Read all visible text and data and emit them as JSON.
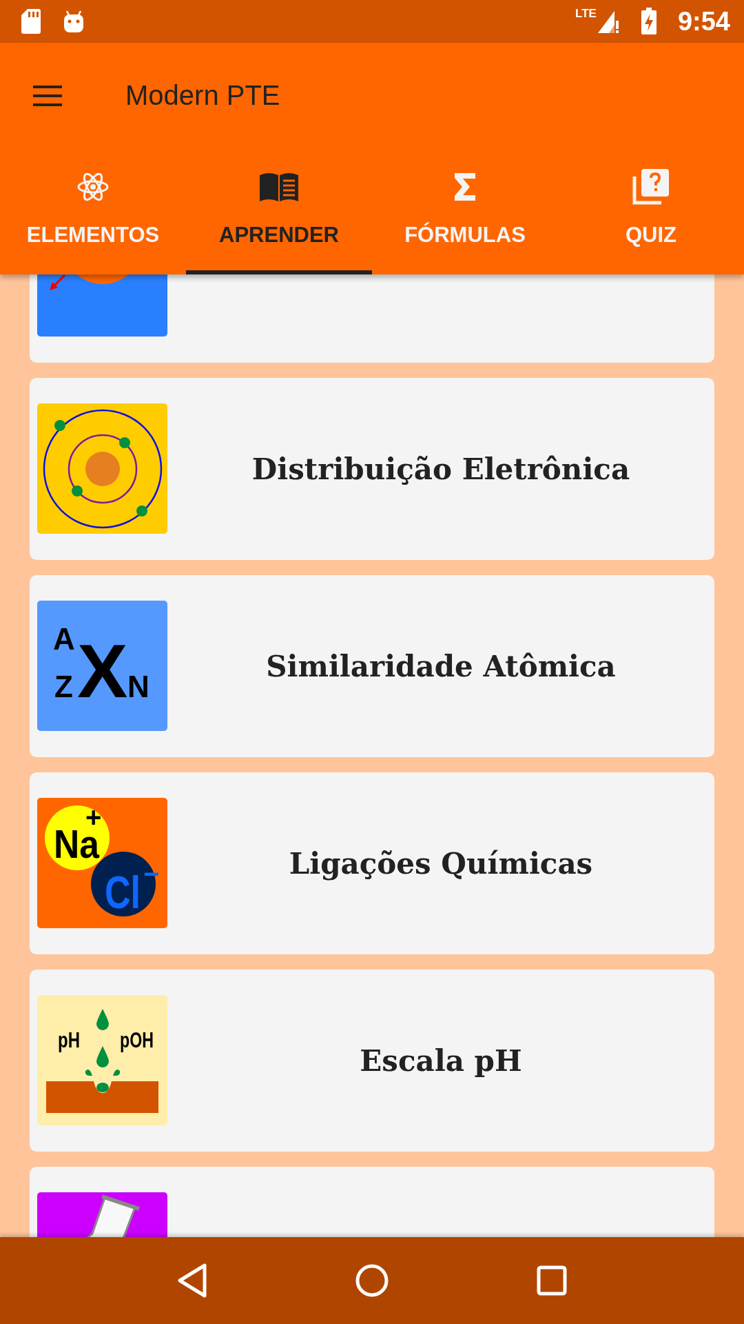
{
  "status_bar": {
    "network": "LTE",
    "time": "9:54"
  },
  "app_bar": {
    "title": "Modern PTE"
  },
  "tabs": [
    {
      "label": "ELEMENTOS",
      "selected": false
    },
    {
      "label": "APRENDER",
      "selected": true
    },
    {
      "label": "FÓRMULAS",
      "selected": false
    },
    {
      "label": "QUIZ",
      "selected": false
    }
  ],
  "topics": [
    {
      "icon": {
        "kind": "pauling"
      }
    },
    {
      "title": "Distribuição Eletrônica",
      "icon": {
        "kind": "orbits"
      }
    },
    {
      "title": "Similaridade Atômica",
      "icon": {
        "kind": "notation",
        "labels": [
          "A",
          "Z",
          "X",
          "N"
        ]
      }
    },
    {
      "title": "Ligações Químicas",
      "icon": {
        "kind": "ions",
        "labels": [
          "Na",
          "+",
          "Cl",
          "−"
        ]
      }
    },
    {
      "title": "Escala pH",
      "icon": {
        "kind": "ph",
        "labels": [
          "pH",
          "pOH"
        ]
      }
    },
    {
      "icon": {
        "kind": "flask"
      }
    }
  ]
}
